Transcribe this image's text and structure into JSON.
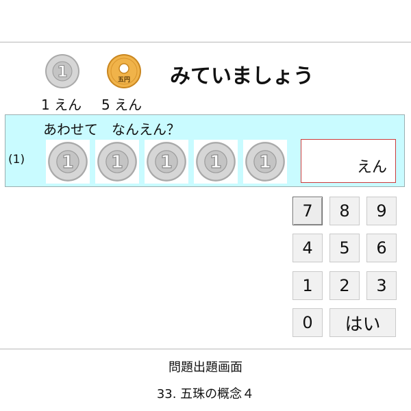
{
  "legend": {
    "coins": [
      {
        "name": "1-yen-coin",
        "label": "1 えん",
        "face": "1"
      },
      {
        "name": "5-yen-coin",
        "label": "5 えん",
        "face": "五円"
      }
    ]
  },
  "header": {
    "title": "みていましょう"
  },
  "question": {
    "number": "(1)",
    "prompt": "あわせて　なんえん？",
    "coin_face": "1",
    "coin_count": 5,
    "answer": {
      "value": "",
      "unit": "えん"
    }
  },
  "keypad": {
    "keys": [
      "7",
      "8",
      "9",
      "4",
      "5",
      "6",
      "1",
      "2",
      "3",
      "0"
    ],
    "submit_label": "はい",
    "focused_key": "7"
  },
  "footer": {
    "screen_name": "問題出題画面",
    "lesson": "33. 五珠の概念４"
  },
  "colors": {
    "question_bg": "#c9fbff",
    "answer_border": "#cc3a3a",
    "one_yen_coin": "#c8c8c8",
    "five_yen_coin": "#e9a93a"
  }
}
